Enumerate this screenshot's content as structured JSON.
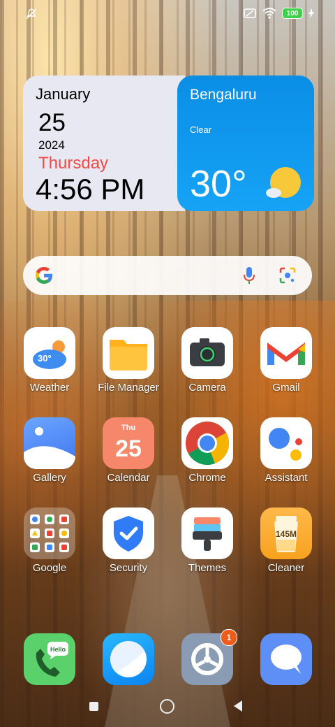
{
  "status_bar": {
    "battery_level": "100",
    "left_icon": "notifications-off-icon",
    "right_icons": [
      "no-sim-icon",
      "wifi-icon",
      "battery-icon",
      "charging-icon"
    ]
  },
  "date_widget": {
    "month": "January",
    "day": "25",
    "year": "2024",
    "weekday": "Thursday",
    "time": "4:56 PM",
    "weekday_color": "#f24a45"
  },
  "weather_widget": {
    "city": "Bengaluru",
    "condition": "Clear",
    "temperature": "30°",
    "background_color": "#16a3f6"
  },
  "search_bar": {
    "icons": [
      "google-logo-icon",
      "microphone-icon",
      "lens-icon"
    ]
  },
  "apps": {
    "row1": [
      {
        "label": "Weather",
        "icon_text": "30°"
      },
      {
        "label": "File Manager"
      },
      {
        "label": "Camera"
      },
      {
        "label": "Gmail"
      }
    ],
    "row2": [
      {
        "label": "Gallery"
      },
      {
        "label": "Calendar",
        "icon_weekday": "Thu",
        "icon_day": "25"
      },
      {
        "label": "Chrome"
      },
      {
        "label": "Assistant"
      }
    ],
    "row3": [
      {
        "label": "Google"
      },
      {
        "label": "Security"
      },
      {
        "label": "Themes"
      },
      {
        "label": "Cleaner",
        "icon_text": "145M"
      }
    ]
  },
  "dock": {
    "phone_bubble_text": "Hello",
    "settings_badge": "1",
    "items": [
      "phone-icon",
      "browser-icon",
      "settings-icon",
      "messages-icon"
    ]
  },
  "nav_bar": {
    "buttons": [
      "recents-button",
      "home-button",
      "back-button"
    ]
  }
}
